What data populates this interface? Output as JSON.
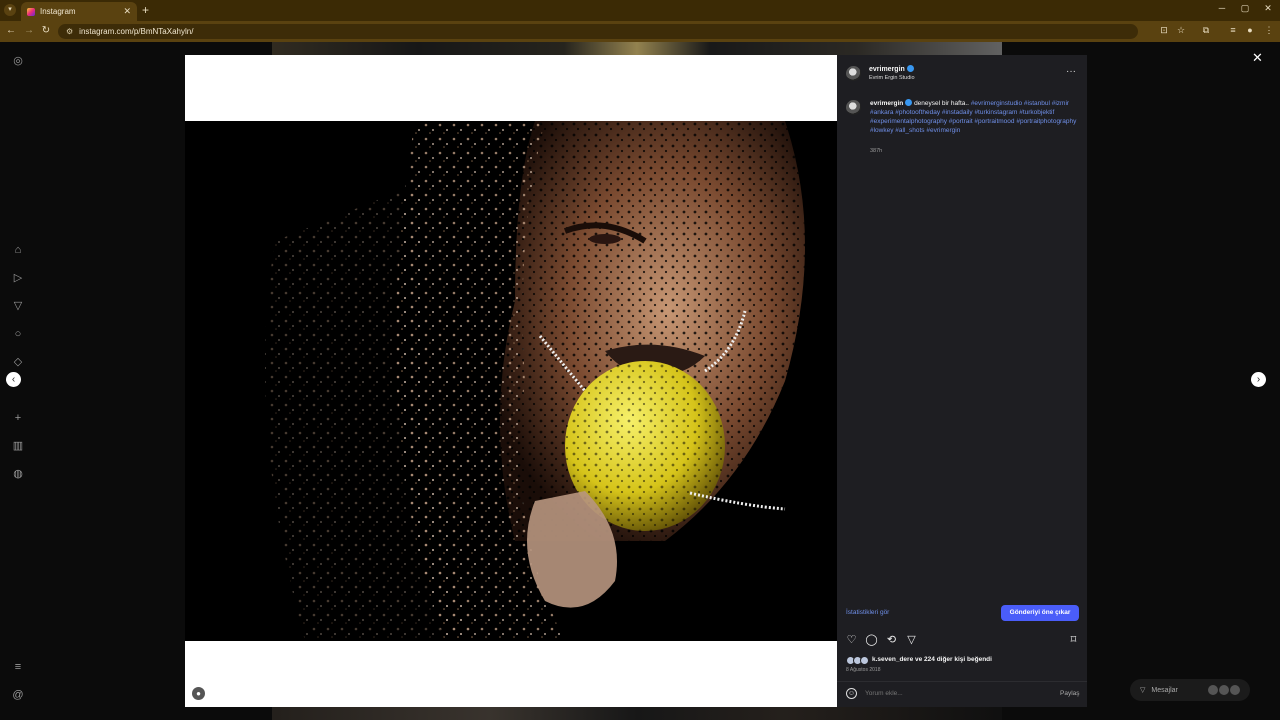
{
  "browser": {
    "tab_title": "Instagram",
    "tab_close": "✕",
    "new_tab": "+",
    "url": "instagram.com/p/BmNTaXahyln/",
    "window_controls": [
      "─",
      "▢",
      "✕"
    ]
  },
  "nav_icons": [
    "instagram-logo-icon",
    "home-icon",
    "reels-icon",
    "messages-icon",
    "search-icon",
    "explore-icon",
    "create-icon",
    "dashboard-icon",
    "profile-icon",
    "menu-icon",
    "threads-icon"
  ],
  "post": {
    "header": {
      "username": "evrimergin",
      "subtitle": "Evrim Ergin Studio",
      "more": "···"
    },
    "caption": {
      "username": "evrimergin",
      "text": "deneysel bir hafta..",
      "hashtags": "#evrimerginstudio #istanbul #izmir #ankara #photooftheday #instadaily #turkinstagram #turkobjektif #experimentalphotography #portrait #portraitmood #portraitphotography #lowkey #all_shots #evrimergin",
      "time": "387h"
    },
    "stats_link": "İstatistikleri gör",
    "boost_button": "Gönderiyi öne çıkar",
    "likes_text": "k.seven_dere ve 224 diğer kişi beğendi",
    "date": "8 Ağustos 2018",
    "comment_placeholder": "Yorum ekle...",
    "share_label": "Paylaş"
  },
  "controls": {
    "close": "✕",
    "prev": "‹",
    "next": "›"
  },
  "messages": {
    "label": "Mesajlar"
  },
  "colors": {
    "accent": "#4a5df9",
    "link": "#6f8fe8",
    "verified": "#3897f0",
    "panel_bg": "#1e1e22"
  }
}
